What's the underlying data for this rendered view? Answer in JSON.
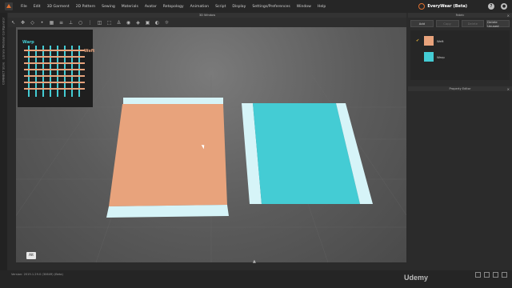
{
  "menubar": {
    "items": [
      "File",
      "Edit",
      "3D Garment",
      "2D Pattern",
      "Sewing",
      "Materials",
      "Avatar",
      "Retopology",
      "Animation",
      "Script",
      "Display",
      "Settings/Preferences",
      "Window",
      "Help"
    ],
    "app_name": "EveryWear (Beta)"
  },
  "side_tabs": [
    "Modular Configurator",
    "Library",
    "CONNECT Store"
  ],
  "window": {
    "title": "3D Window"
  },
  "viewport": {
    "alt_label": "Alt",
    "thumbnail": {
      "warp_label": "Warp",
      "weft_label": "Weft"
    },
    "colors": {
      "orange": "#e8a37c",
      "teal": "#44ccd4",
      "edge": "#d6f4f8"
    }
  },
  "fabric_panel": {
    "title": "Fabric",
    "buttons": [
      "Add",
      "Copy",
      "Delete",
      "Delete Unused"
    ],
    "items": [
      {
        "name": "Weft",
        "color": "#e8a37c",
        "checked": true
      },
      {
        "name": "Warp",
        "color": "#44ccd4",
        "checked": false
      }
    ]
  },
  "property_editor": {
    "title": "Property Editor"
  },
  "status": {
    "version_text": "Version: 2019.1.29.0 (30649) (Beta)"
  },
  "watermark": "Udemy"
}
